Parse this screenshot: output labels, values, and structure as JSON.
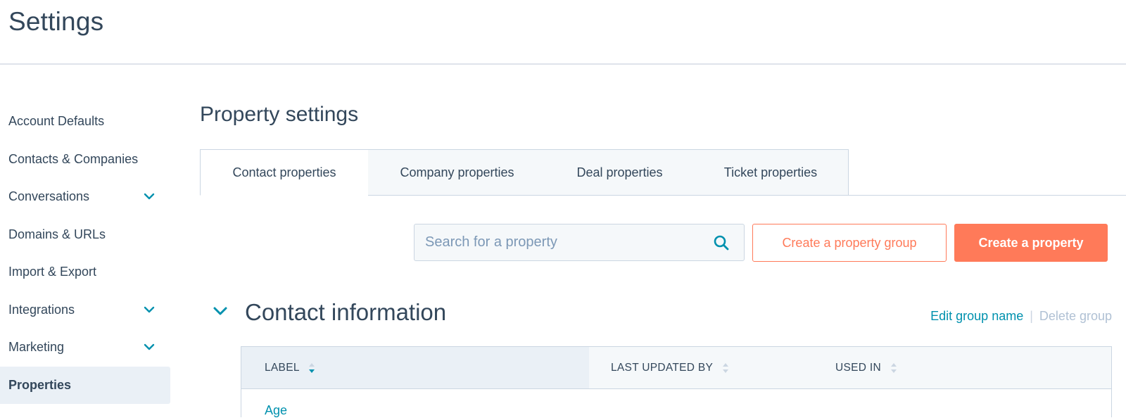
{
  "header": {
    "title": "Settings"
  },
  "sidebar": {
    "items": [
      {
        "label": "Account Defaults",
        "has_chevron": false,
        "active": false
      },
      {
        "label": "Contacts & Companies",
        "has_chevron": false,
        "active": false
      },
      {
        "label": "Conversations",
        "has_chevron": true,
        "active": false
      },
      {
        "label": "Domains & URLs",
        "has_chevron": false,
        "active": false
      },
      {
        "label": "Import & Export",
        "has_chevron": false,
        "active": false
      },
      {
        "label": "Integrations",
        "has_chevron": true,
        "active": false
      },
      {
        "label": "Marketing",
        "has_chevron": true,
        "active": false
      },
      {
        "label": "Properties",
        "has_chevron": false,
        "active": true
      }
    ]
  },
  "main": {
    "title": "Property settings",
    "tabs": [
      {
        "label": "Contact properties",
        "active": true
      },
      {
        "label": "Company properties",
        "active": false
      },
      {
        "label": "Deal properties",
        "active": false
      },
      {
        "label": "Ticket properties",
        "active": false
      }
    ],
    "search": {
      "placeholder": "Search for a property",
      "value": "",
      "icon": "search-icon"
    },
    "buttons": {
      "create_group": "Create a property group",
      "create_property": "Create a property"
    },
    "group": {
      "title": "Contact information",
      "edit_label": "Edit group name",
      "separator": "|",
      "delete_label": "Delete group"
    },
    "table": {
      "columns": [
        "LABEL",
        "LAST UPDATED BY",
        "USED IN"
      ],
      "rows": [
        {
          "label": "Age"
        }
      ]
    }
  },
  "colors": {
    "text": "#33475b",
    "accent_orange": "#ff7a59",
    "link_teal": "#0091ae",
    "border": "#cbd6e2",
    "surface": "#f5f8fa",
    "active_surface": "#eaf0f6"
  }
}
